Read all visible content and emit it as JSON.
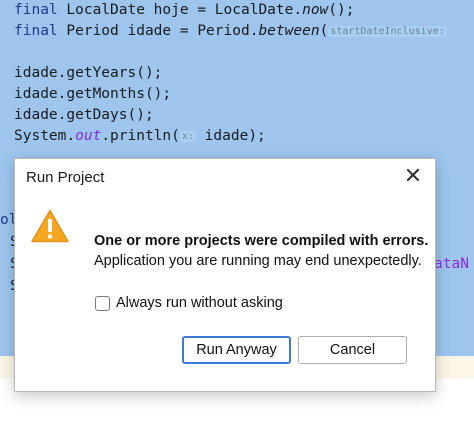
{
  "editor": {
    "lines": [
      {
        "kw": "final",
        "code1": " LocalDate hoje = LocalDate.",
        "italic": "now",
        "code2": "();",
        "hint": "",
        "code3": ""
      },
      {
        "kw": "final",
        "code1": " Period idade = Period.",
        "italic": "between",
        "code2": "(",
        "hint": "startDateInclusive:",
        "code3": ""
      },
      {
        "kw": "",
        "code1": "",
        "italic": "",
        "code2": "",
        "hint": "",
        "code3": ""
      },
      {
        "kw": "",
        "code1": "idade.getYears();",
        "italic": "",
        "code2": "",
        "hint": "",
        "code3": ""
      },
      {
        "kw": "",
        "code1": "idade.getMonths();",
        "italic": "",
        "code2": "",
        "hint": "",
        "code3": ""
      },
      {
        "kw": "",
        "code1": "idade.getDays();",
        "italic": "",
        "code2": "",
        "hint": "",
        "code3": ""
      },
      {
        "kw": "",
        "code1": "System.",
        "italic": "out",
        "code2": ".println(",
        "hint": "x:",
        "code3": " idade);"
      }
    ],
    "left_fragments": [
      "ol",
      "S",
      "S",
      "S"
    ],
    "right_fragment": "ataN"
  },
  "dialog": {
    "title": "Run Project",
    "close_symbol": "✕",
    "icon": "warning-triangle-icon",
    "message_bold": "One or more projects were compiled with errors.",
    "message": "Application you are running may end unexpectedly.",
    "checkbox_label": "Always run without asking",
    "checkbox_checked": false,
    "primary_button": "Run Anyway",
    "secondary_button": "Cancel"
  },
  "colors": {
    "editor_background": "#9dc5ee",
    "warning": "#f5a623",
    "primary_border": "#3d7bd6"
  }
}
